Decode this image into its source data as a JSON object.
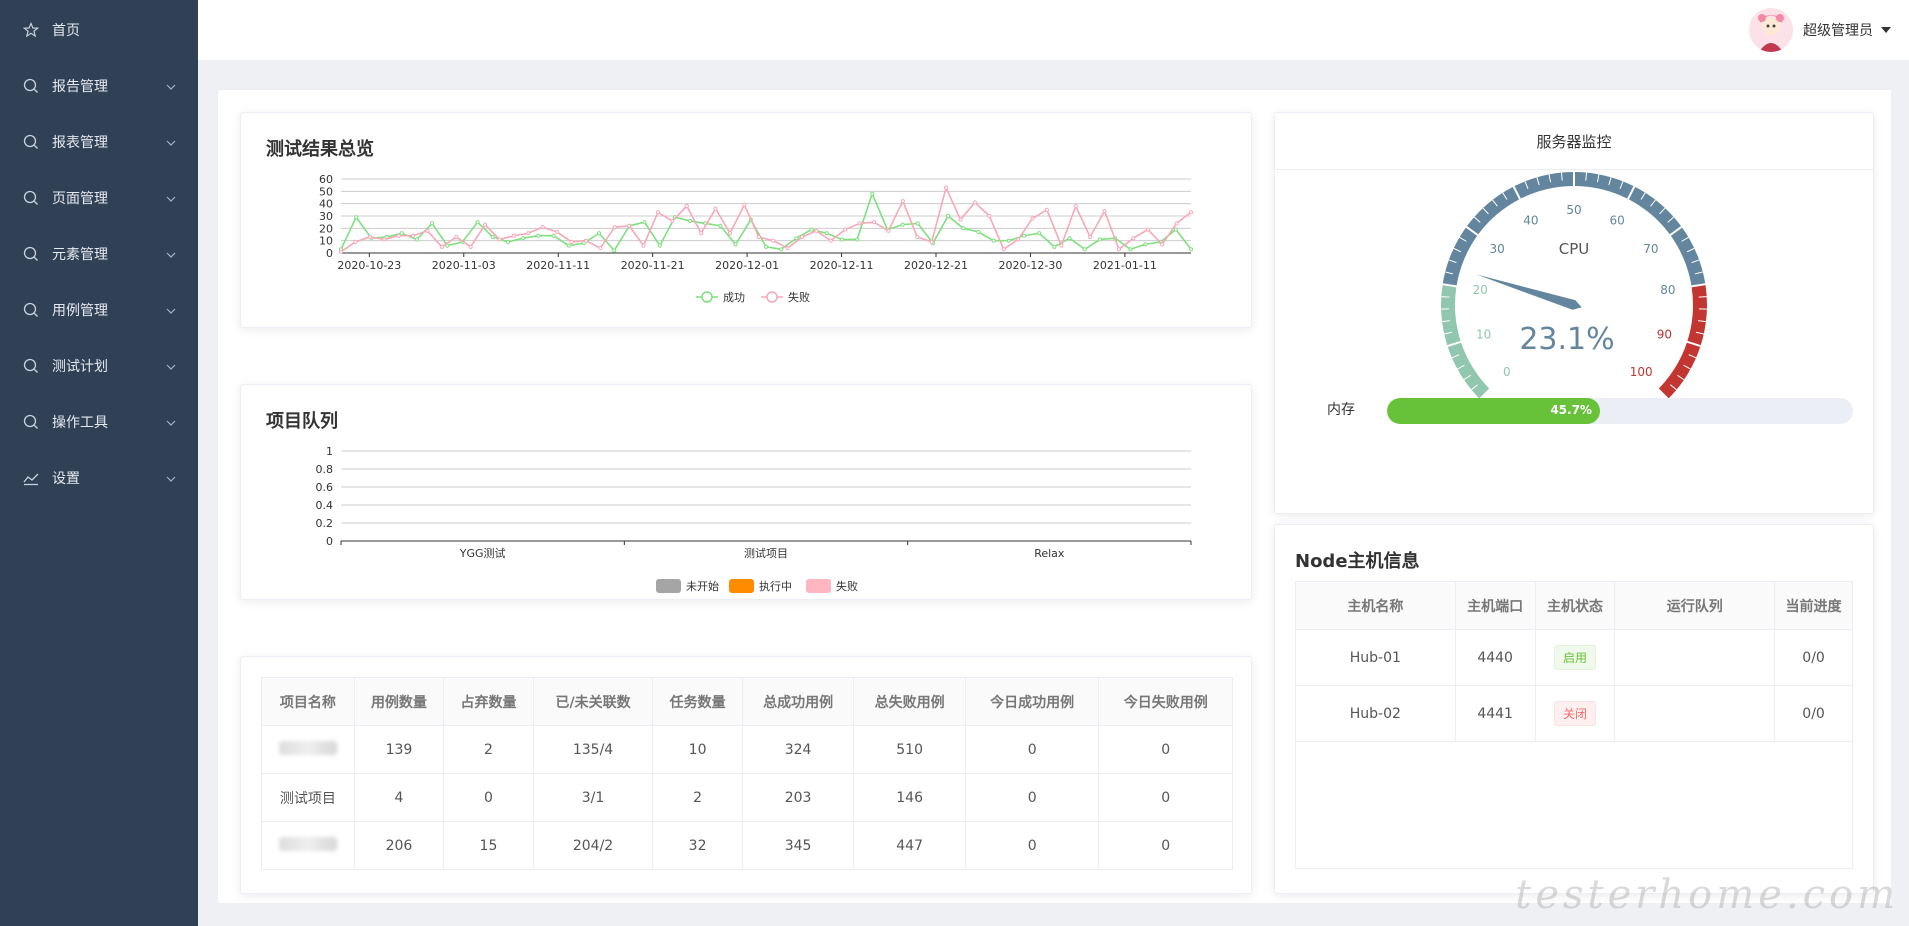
{
  "sidebar": {
    "items": [
      {
        "label": "首页",
        "icon": "star-icon",
        "expandable": false
      },
      {
        "label": "报告管理",
        "icon": "search-icon",
        "expandable": true
      },
      {
        "label": "报表管理",
        "icon": "search-icon",
        "expandable": true
      },
      {
        "label": "页面管理",
        "icon": "search-icon",
        "expandable": true
      },
      {
        "label": "元素管理",
        "icon": "search-icon",
        "expandable": true
      },
      {
        "label": "用例管理",
        "icon": "search-icon",
        "expandable": true
      },
      {
        "label": "测试计划",
        "icon": "search-icon",
        "expandable": true
      },
      {
        "label": "操作工具",
        "icon": "search-icon",
        "expandable": true
      },
      {
        "label": "设置",
        "icon": "chart-icon",
        "expandable": true
      }
    ]
  },
  "header": {
    "user_name": "超级管理员"
  },
  "results_card": {
    "title": "测试结果总览"
  },
  "queue_card": {
    "title": "项目队列"
  },
  "server_card": {
    "title": "服务器监控",
    "cpu_label": "CPU",
    "cpu_value": 23.1,
    "cpu_text": "23.1%",
    "gauge_ticks": [
      "0",
      "10",
      "20",
      "30",
      "40",
      "50",
      "60",
      "70",
      "80",
      "90",
      "100"
    ],
    "memory_label": "内存",
    "memory_value": 45.7,
    "memory_text": "45.7%",
    "colors": {
      "low": "#91c7ae",
      "mid": "#63869e",
      "high": "#c23531",
      "memory": "#67c23a"
    }
  },
  "project_table": {
    "headers": [
      "项目名称",
      "用例数量",
      "占弃数量",
      "已/未关联数",
      "任务数量",
      "总成功用例",
      "总失败用例",
      "今日成功用例",
      "今日失败用例"
    ],
    "rows": [
      {
        "name": "",
        "blurred": true,
        "cells": [
          "139",
          "2",
          "135/4",
          "10",
          "324",
          "510",
          "0",
          "0"
        ]
      },
      {
        "name": "测试项目",
        "blurred": false,
        "cells": [
          "4",
          "0",
          "3/1",
          "2",
          "203",
          "146",
          "0",
          "0"
        ]
      },
      {
        "name": "",
        "blurred": true,
        "cells": [
          "206",
          "15",
          "204/2",
          "32",
          "345",
          "447",
          "0",
          "0"
        ]
      }
    ]
  },
  "node_card": {
    "title": "Node主机信息",
    "headers": [
      "主机名称",
      "主机端口",
      "主机状态",
      "运行队列",
      "当前进度"
    ],
    "rows": [
      {
        "name": "Hub-01",
        "port": "4440",
        "status": "启用",
        "status_type": "on",
        "queue": "",
        "progress": "0/0"
      },
      {
        "name": "Hub-02",
        "port": "4441",
        "status": "关闭",
        "status_type": "off",
        "queue": "",
        "progress": "0/0"
      }
    ]
  },
  "watermark": "testerhome.com",
  "chart_data": [
    {
      "type": "line",
      "title": "测试结果总览",
      "x_tick_labels": [
        "2020-10-23",
        "2020-11-03",
        "2020-11-11",
        "2020-11-21",
        "2020-12-01",
        "2020-12-11",
        "2020-12-21",
        "2020-12-30",
        "2021-01-11"
      ],
      "ylim": [
        0,
        60
      ],
      "y_ticks": [
        0,
        10,
        20,
        30,
        40,
        50,
        60
      ],
      "grid": true,
      "legend_position": "bottom-center",
      "series": [
        {
          "name": "成功",
          "color": "#7fe07f",
          "values": [
            3,
            29,
            12,
            13,
            16,
            11,
            24,
            6,
            9,
            25,
            13,
            9,
            12,
            14,
            14,
            6,
            8,
            16,
            2,
            22,
            25,
            6,
            29,
            26,
            24,
            22,
            7,
            27,
            5,
            3,
            12,
            19,
            16,
            11,
            11,
            48,
            19,
            23,
            24,
            8,
            30,
            20,
            17,
            10,
            10,
            14,
            16,
            5,
            12,
            3,
            11,
            12,
            3,
            7,
            9,
            19,
            3
          ]
        },
        {
          "name": "失败",
          "color": "#f7a8b8",
          "values": [
            1,
            9,
            13,
            11,
            14,
            14,
            18,
            5,
            13,
            5,
            23,
            11,
            14,
            16,
            21,
            17,
            9,
            10,
            4,
            21,
            22,
            6,
            33,
            26,
            38,
            16,
            36,
            16,
            39,
            13,
            10,
            4,
            13,
            18,
            10,
            19,
            24,
            25,
            18,
            42,
            13,
            9,
            53,
            27,
            41,
            30,
            3,
            11,
            28,
            35,
            6,
            38,
            13,
            34,
            3,
            12,
            19,
            7,
            24,
            33
          ]
        }
      ]
    },
    {
      "type": "bar",
      "title": "项目队列",
      "categories": [
        "YGG测试",
        "测试项目",
        "Relax"
      ],
      "ylim": [
        0,
        1
      ],
      "y_ticks": [
        0,
        0.2,
        0.4,
        0.6,
        0.8,
        1
      ],
      "grid": true,
      "legend_position": "bottom-center",
      "series": [
        {
          "name": "未开始",
          "color": "#a5a5a5",
          "values": [
            0,
            0,
            0
          ]
        },
        {
          "name": "执行中",
          "color": "#ff8c00",
          "values": [
            0,
            0,
            0
          ]
        },
        {
          "name": "失败",
          "color": "#ffb6c1",
          "values": [
            0,
            0,
            0
          ]
        }
      ]
    }
  ]
}
